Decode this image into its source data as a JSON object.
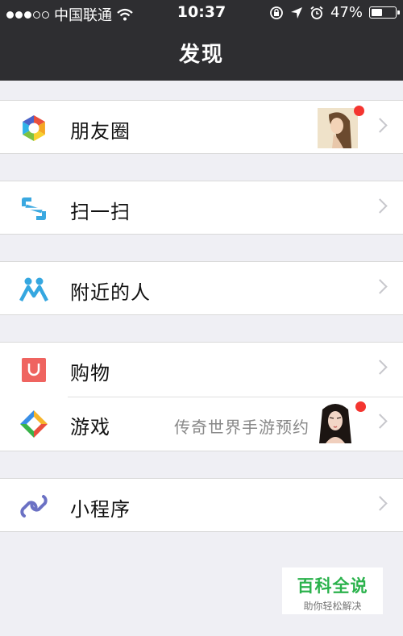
{
  "status_bar": {
    "carrier": "中国联通",
    "time": "10:37",
    "battery": "47%",
    "battery_level": 0.47
  },
  "nav": {
    "title": "发现"
  },
  "items": [
    {
      "label": "朋友圈",
      "has_thumbnail": true,
      "has_red_dot": true
    },
    {
      "label": "扫一扫"
    },
    {
      "label": "附近的人"
    },
    {
      "label": "购物"
    },
    {
      "label": "游戏",
      "subtitle": "传奇世界手游预约",
      "has_thumbnail": true,
      "has_red_dot": true
    },
    {
      "label": "小程序"
    }
  ],
  "watermark": {
    "title": "百科全说",
    "subtitle": "助你轻松解决"
  },
  "colors": {
    "nav_bg": "#2e2e31",
    "page_bg": "#efeff4",
    "badge_red": "#f43530",
    "watermark_green": "#2bb24c"
  }
}
